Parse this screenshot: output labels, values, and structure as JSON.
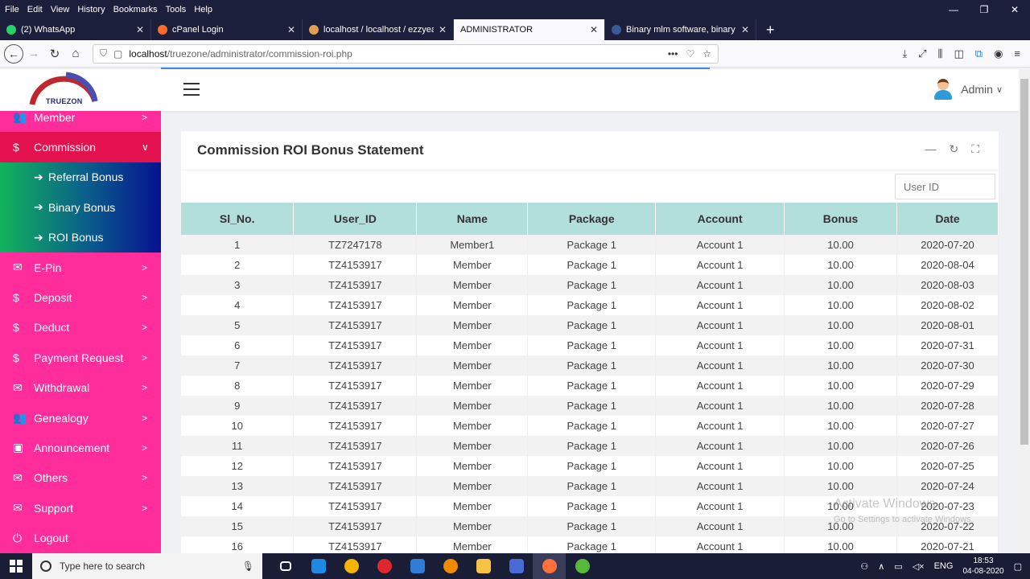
{
  "browser": {
    "menu": [
      "File",
      "Edit",
      "View",
      "History",
      "Bookmarks",
      "Tools",
      "Help"
    ],
    "window_controls": [
      "—",
      "❐",
      "✕"
    ],
    "tabs": [
      {
        "label": "(2) WhatsApp",
        "icon_color": "#25d366"
      },
      {
        "label": "cPanel Login",
        "icon_color": "#ff6c2c"
      },
      {
        "label": "localhost / localhost / ezzyearn",
        "icon_color": "#e0a050"
      },
      {
        "label": "ADMINISTRATOR",
        "icon_color": "#f9f9fb"
      },
      {
        "label": "Binary mlm software, binary mlm so",
        "icon_color": "#3b5998"
      }
    ],
    "url_host": "localhost",
    "url_path": "/truezone/administrator/commission-roi.php",
    "url_dots": "•••"
  },
  "header": {
    "logo_text": "TRUEZON",
    "admin_label": "Admin",
    "admin_caret": "∨"
  },
  "sidebar": {
    "items": [
      {
        "label": "Member",
        "icon": "users-icon",
        "glyph": "👥",
        "arrow": ">"
      },
      {
        "label": "Commission",
        "icon": "dollar-icon",
        "glyph": "$",
        "arrow": "∨"
      },
      {
        "label": "E-Pin",
        "icon": "envelope-icon",
        "glyph": "✉",
        "arrow": ">"
      },
      {
        "label": "Deposit",
        "icon": "dollar-icon",
        "glyph": "$",
        "arrow": ">"
      },
      {
        "label": "Deduct",
        "icon": "dollar-icon",
        "glyph": "$",
        "arrow": ">"
      },
      {
        "label": "Payment Request",
        "icon": "dollar-icon",
        "glyph": "$",
        "arrow": ">"
      },
      {
        "label": "Withdrawal",
        "icon": "envelope-icon",
        "glyph": "✉",
        "arrow": ">"
      },
      {
        "label": "Genealogy",
        "icon": "users-icon",
        "glyph": "👥",
        "arrow": ">"
      },
      {
        "label": "Announcement",
        "icon": "bullhorn-icon",
        "glyph": "▣",
        "arrow": ">"
      },
      {
        "label": "Others",
        "icon": "envelope-icon",
        "glyph": "✉",
        "arrow": ">"
      },
      {
        "label": "Support",
        "icon": "envelope-icon",
        "glyph": "✉",
        "arrow": ">"
      },
      {
        "label": "Logout",
        "icon": "power-icon",
        "glyph": "⏻",
        "arrow": ""
      }
    ],
    "submenu": [
      {
        "label": "Referral Bonus"
      },
      {
        "label": "Binary Bonus"
      },
      {
        "label": "ROI Bonus"
      }
    ]
  },
  "panel": {
    "title": "Commission ROI Bonus Statement",
    "search_placeholder": "User ID",
    "tool_minimize": "—",
    "tool_refresh": "↻",
    "tool_expand": "⛶"
  },
  "table": {
    "headers": [
      "Sl_No.",
      "User_ID",
      "Name",
      "Package",
      "Account",
      "Bonus",
      "Date"
    ],
    "rows": [
      [
        "1",
        "TZ7247178",
        "Member1",
        "Package 1",
        "Account 1",
        "10.00",
        "2020-07-20"
      ],
      [
        "2",
        "TZ4153917",
        "Member",
        "Package 1",
        "Account 1",
        "10.00",
        "2020-08-04"
      ],
      [
        "3",
        "TZ4153917",
        "Member",
        "Package 1",
        "Account 1",
        "10.00",
        "2020-08-03"
      ],
      [
        "4",
        "TZ4153917",
        "Member",
        "Package 1",
        "Account 1",
        "10.00",
        "2020-08-02"
      ],
      [
        "5",
        "TZ4153917",
        "Member",
        "Package 1",
        "Account 1",
        "10.00",
        "2020-08-01"
      ],
      [
        "6",
        "TZ4153917",
        "Member",
        "Package 1",
        "Account 1",
        "10.00",
        "2020-07-31"
      ],
      [
        "7",
        "TZ4153917",
        "Member",
        "Package 1",
        "Account 1",
        "10.00",
        "2020-07-30"
      ],
      [
        "8",
        "TZ4153917",
        "Member",
        "Package 1",
        "Account 1",
        "10.00",
        "2020-07-29"
      ],
      [
        "9",
        "TZ4153917",
        "Member",
        "Package 1",
        "Account 1",
        "10.00",
        "2020-07-28"
      ],
      [
        "10",
        "TZ4153917",
        "Member",
        "Package 1",
        "Account 1",
        "10.00",
        "2020-07-27"
      ],
      [
        "11",
        "TZ4153917",
        "Member",
        "Package 1",
        "Account 1",
        "10.00",
        "2020-07-26"
      ],
      [
        "12",
        "TZ4153917",
        "Member",
        "Package 1",
        "Account 1",
        "10.00",
        "2020-07-25"
      ],
      [
        "13",
        "TZ4153917",
        "Member",
        "Package 1",
        "Account 1",
        "10.00",
        "2020-07-24"
      ],
      [
        "14",
        "TZ4153917",
        "Member",
        "Package 1",
        "Account 1",
        "10.00",
        "2020-07-23"
      ],
      [
        "15",
        "TZ4153917",
        "Member",
        "Package 1",
        "Account 1",
        "10.00",
        "2020-07-22"
      ],
      [
        "16",
        "TZ4153917",
        "Member",
        "Package 1",
        "Account 1",
        "10.00",
        "2020-07-21"
      ]
    ]
  },
  "watermark": {
    "line1": "Activate Windows",
    "line2": "Go to Settings to activate Windows."
  },
  "taskbar": {
    "search_placeholder": "Type here to search",
    "apps": [
      {
        "name": "task-view-icon",
        "color": "#1a1d36"
      },
      {
        "name": "edge-icon",
        "color": "#1e88e5"
      },
      {
        "name": "chrome-icon",
        "color": "#f4b400"
      },
      {
        "name": "opera-icon",
        "color": "#e0262e"
      },
      {
        "name": "mail-icon",
        "color": "#2f7bd6"
      },
      {
        "name": "vlc-icon",
        "color": "#f08a00"
      },
      {
        "name": "file-explorer-icon",
        "color": "#f6c342"
      },
      {
        "name": "store-icon",
        "color": "#4a6bd6"
      },
      {
        "name": "firefox-icon",
        "color": "#ff7139"
      },
      {
        "name": "app-icon",
        "color": "#56b93a"
      }
    ],
    "lang": "ENG",
    "time": "18:53",
    "date": "04-08-2020"
  }
}
